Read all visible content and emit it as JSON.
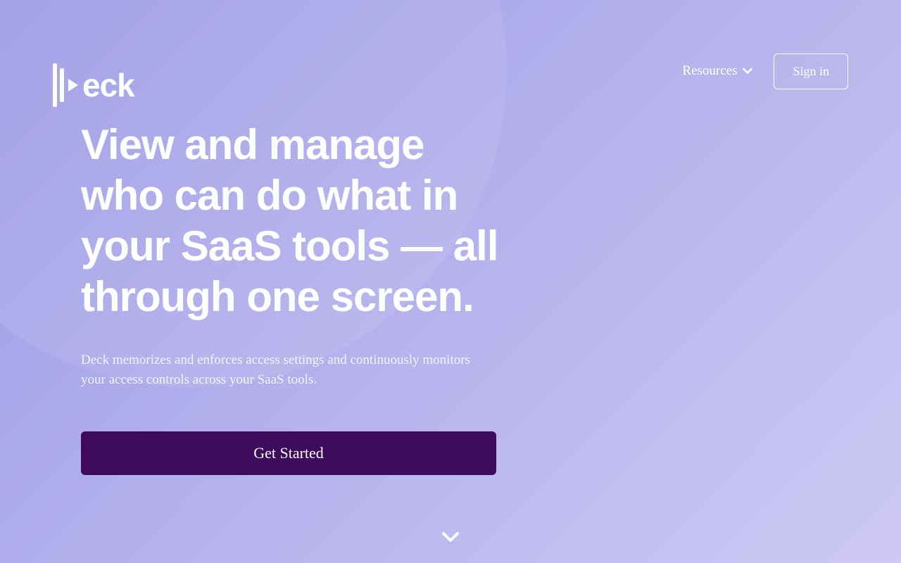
{
  "header": {
    "logo_text": "eck",
    "nav": {
      "resources_label": "Resources",
      "signin_label": "Sign in"
    }
  },
  "main": {
    "headline": "View and manage who can do what in your SaaS tools — all through one screen.",
    "subtitle": "Deck memorizes and enforces access settings and continuously monitors your access controls across your SaaS tools.",
    "cta_label": "Get Started"
  },
  "colors": {
    "cta_bg": "#3d0a5c",
    "gradient_start": "#9d9ae6",
    "gradient_end": "#cdc9f3"
  }
}
